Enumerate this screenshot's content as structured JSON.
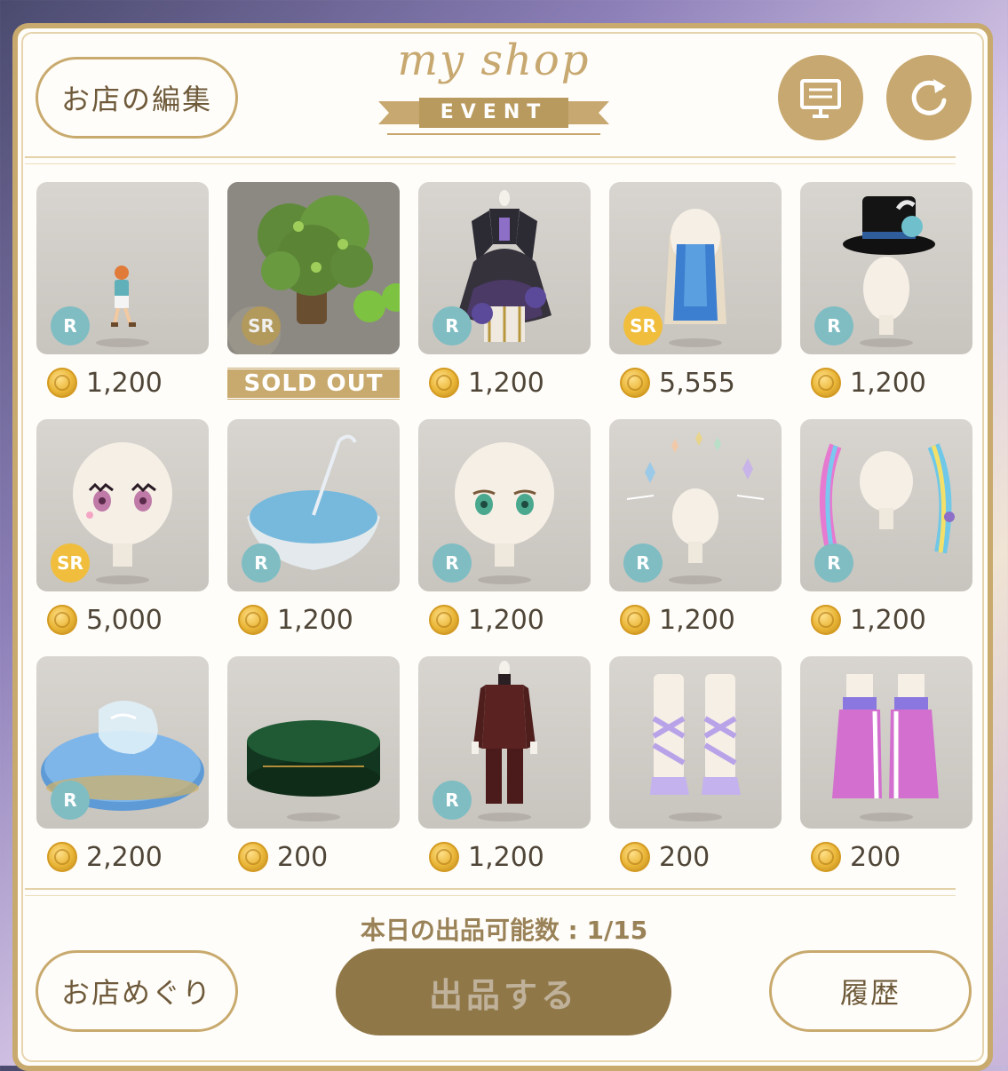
{
  "header": {
    "edit_shop_label": "お店の編集",
    "logo_title": "my shop",
    "logo_sub": "EVENT",
    "board_icon": "notice-board-icon",
    "refresh_icon": "refresh-icon"
  },
  "colors": {
    "gold": "#c8aa6e",
    "rarity_r": "#7fbdc3",
    "rarity_sr": "#f0be3c",
    "tile_bg": "#d2cec8"
  },
  "items": [
    {
      "art": "boy-figure",
      "rarity": "R",
      "price": "1,200"
    },
    {
      "art": "apple-tree",
      "rarity": "SR",
      "sold_out": "SOLD OUT"
    },
    {
      "art": "gothic-dress",
      "rarity": "R",
      "price": "1,200"
    },
    {
      "art": "blue-long-hair",
      "rarity": "SR",
      "price": "5,555"
    },
    {
      "art": "top-hat",
      "rarity": "R",
      "price": "1,200"
    },
    {
      "art": "pink-eyes-face",
      "rarity": "SR",
      "price": "5,000"
    },
    {
      "art": "upside-down-umbrella",
      "rarity": "R",
      "price": "1,200"
    },
    {
      "art": "green-eyes-face",
      "rarity": "R",
      "price": "1,200"
    },
    {
      "art": "crystal-halo",
      "rarity": "R",
      "price": "1,200"
    },
    {
      "art": "rainbow-braids",
      "rarity": "R",
      "price": "1,200"
    },
    {
      "art": "glass-slipper-cushion",
      "rarity": "R",
      "price": "2,200"
    },
    {
      "art": "green-round-pedestal",
      "rarity": "",
      "price": "200"
    },
    {
      "art": "brown-suit",
      "rarity": "R",
      "price": "1,200"
    },
    {
      "art": "lavender-boots",
      "rarity": "",
      "price": "200"
    },
    {
      "art": "pink-track-pants",
      "rarity": "",
      "price": "200"
    }
  ],
  "footer": {
    "counter_text": "本日の出品可能数 : 1/15",
    "browse_label": "お店めぐり",
    "list_label": "出品する",
    "history_label": "履歴"
  }
}
